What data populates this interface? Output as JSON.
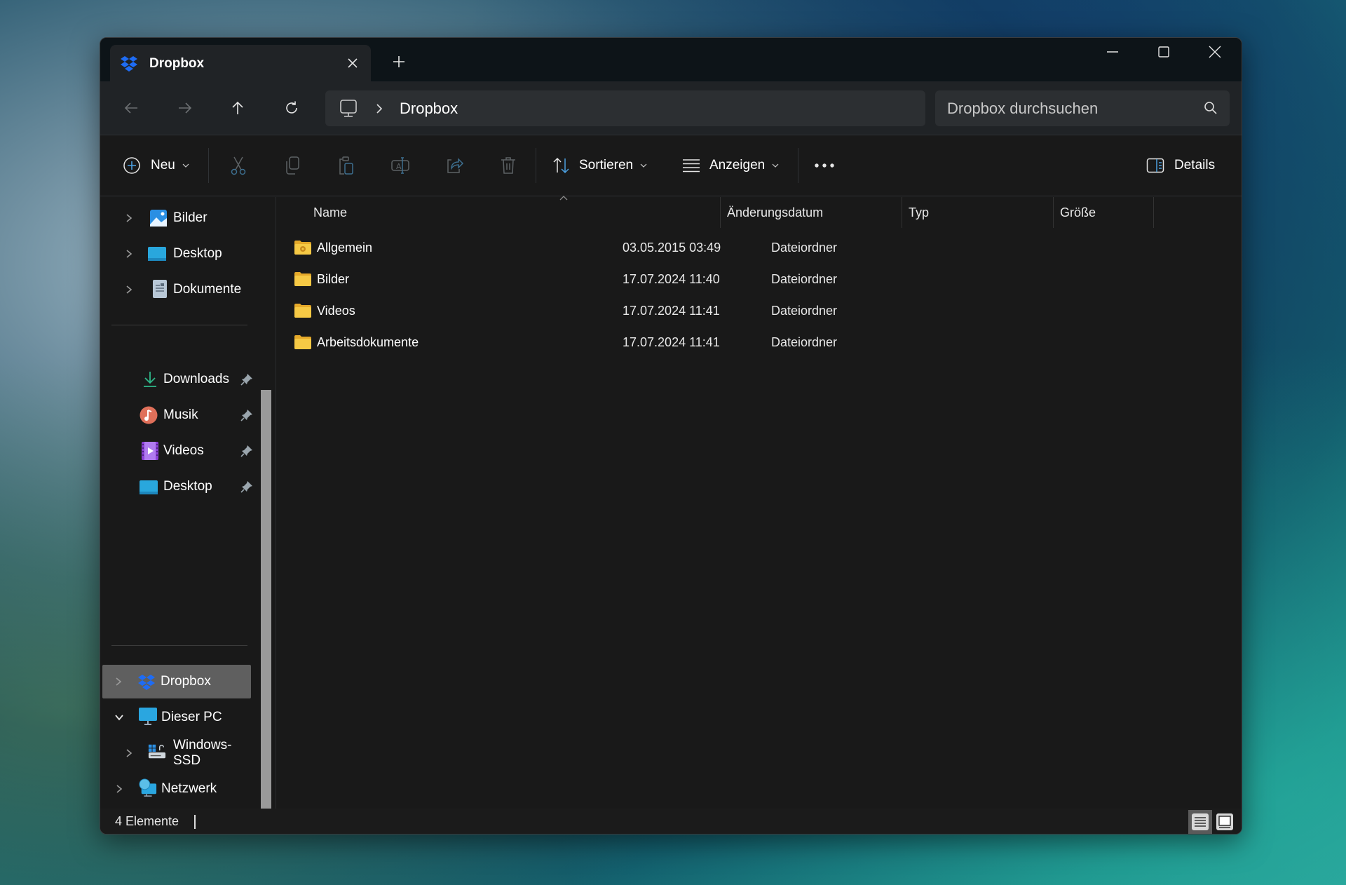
{
  "window": {
    "tab_title": "Dropbox",
    "tab_icon": "dropbox-icon",
    "new_tab_label": "+",
    "controls": [
      "minimize",
      "maximize",
      "close"
    ]
  },
  "nav": {
    "back_icon": "arrow-left-icon",
    "forward_icon": "arrow-right-icon",
    "up_icon": "arrow-up-icon",
    "refresh_icon": "refresh-icon",
    "breadcrumb": [
      "Dropbox"
    ],
    "search_placeholder": "Dropbox durchsuchen"
  },
  "toolbar": {
    "new_label": "Neu",
    "sort_label": "Sortieren",
    "view_label": "Anzeigen",
    "more_label": "•••",
    "details_label": "Details",
    "actions": [
      "cut",
      "copy",
      "paste",
      "rename",
      "share",
      "delete"
    ]
  },
  "sidebar": {
    "tree_top": [
      {
        "label": "Bilder",
        "icon": "pictures-icon"
      },
      {
        "label": "Desktop",
        "icon": "desktop-icon"
      },
      {
        "label": "Dokumente",
        "icon": "documents-icon"
      }
    ],
    "pinned": [
      {
        "label": "Downloads",
        "icon": "downloads-icon",
        "pinned": true
      },
      {
        "label": "Musik",
        "icon": "music-icon",
        "pinned": true
      },
      {
        "label": "Videos",
        "icon": "videos-icon",
        "pinned": true
      },
      {
        "label": "Desktop",
        "icon": "desktop-icon",
        "pinned": true
      }
    ],
    "locations": [
      {
        "label": "Dropbox",
        "icon": "dropbox-icon",
        "selected": true,
        "expanded": false
      },
      {
        "label": "Dieser PC",
        "icon": "this-pc-icon",
        "expanded": true
      },
      {
        "label": "Windows-SSD",
        "icon": "drive-icon",
        "expanded": false
      },
      {
        "label": "Netzwerk",
        "icon": "network-icon",
        "expanded": false
      }
    ]
  },
  "columns": [
    "Name",
    "Änderungsdatum",
    "Typ",
    "Größe"
  ],
  "files": [
    {
      "name": "Allgemein",
      "date": "03.05.2015 03:49",
      "type": "Dateiordner",
      "size": "",
      "icon": "shared-folder-icon"
    },
    {
      "name": "Bilder",
      "date": "17.07.2024 11:40",
      "type": "Dateiordner",
      "size": "",
      "icon": "folder-icon"
    },
    {
      "name": "Videos",
      "date": "17.07.2024 11:41",
      "type": "Dateiordner",
      "size": "",
      "icon": "folder-icon"
    },
    {
      "name": "Arbeitsdokumente",
      "date": "17.07.2024 11:41",
      "type": "Dateiordner",
      "size": "",
      "icon": "folder-icon"
    }
  ],
  "status": {
    "item_count": "4 Elemente",
    "active_view": "details"
  },
  "colors": {
    "accent": "#4ca0e0",
    "dropbox_blue": "#1e6cf5",
    "folder_yellow": "#f6c945",
    "window_bg": "#191919",
    "titlebar_bg": "#0d1418",
    "navbar_bg": "#202326",
    "selected_bg": "#5f5f5f"
  }
}
